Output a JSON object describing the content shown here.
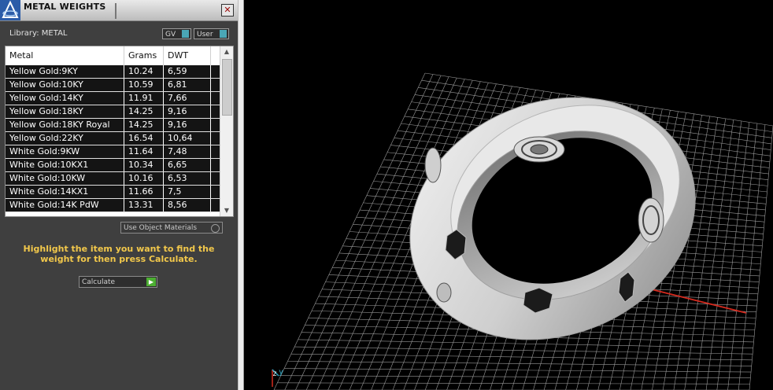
{
  "window": {
    "title": "METAL WEIGHTS",
    "close_symbol": "✕"
  },
  "library": {
    "label": "Library: METAL",
    "toggles": [
      "GV",
      "User"
    ]
  },
  "table": {
    "columns": [
      "Metal",
      "Grams",
      "DWT"
    ],
    "rows": [
      {
        "metal": "Yellow Gold:9KY",
        "grams": "10.24",
        "dwt": "6,59"
      },
      {
        "metal": "Yellow Gold:10KY",
        "grams": "10.59",
        "dwt": "6,81"
      },
      {
        "metal": "Yellow Gold:14KY",
        "grams": "11.91",
        "dwt": "7,66"
      },
      {
        "metal": "Yellow Gold:18KY",
        "grams": "14.25",
        "dwt": "9,16"
      },
      {
        "metal": "Yellow Gold:18KY Royal",
        "grams": "14.25",
        "dwt": "9,16"
      },
      {
        "metal": "Yellow Gold:22KY",
        "grams": "16.54",
        "dwt": "10,64"
      },
      {
        "metal": "White Gold:9KW",
        "grams": "11.64",
        "dwt": "7,48"
      },
      {
        "metal": "White Gold:10KX1",
        "grams": "10.34",
        "dwt": "6,65"
      },
      {
        "metal": "White Gold:10KW",
        "grams": "10.16",
        "dwt": "6,53"
      },
      {
        "metal": "White Gold:14KX1",
        "grams": "11.66",
        "dwt": "7,5"
      },
      {
        "metal": "White Gold:14K PdW",
        "grams": "13.31",
        "dwt": "8,56"
      }
    ]
  },
  "options": {
    "use_object_materials": "Use Object Materials"
  },
  "hint": "Highlight the item you want to find the weight for then press Calculate.",
  "calculate_button": "Calculate",
  "viewport": {
    "axis_z": "z",
    "axis_y": "y",
    "colors": {
      "grid": "#9a9a9a",
      "x_axis": "#d42a1e",
      "y_axis": "#2aa7c4",
      "ring": "#dcdcdc",
      "hint_text": "#f2c84b"
    }
  }
}
